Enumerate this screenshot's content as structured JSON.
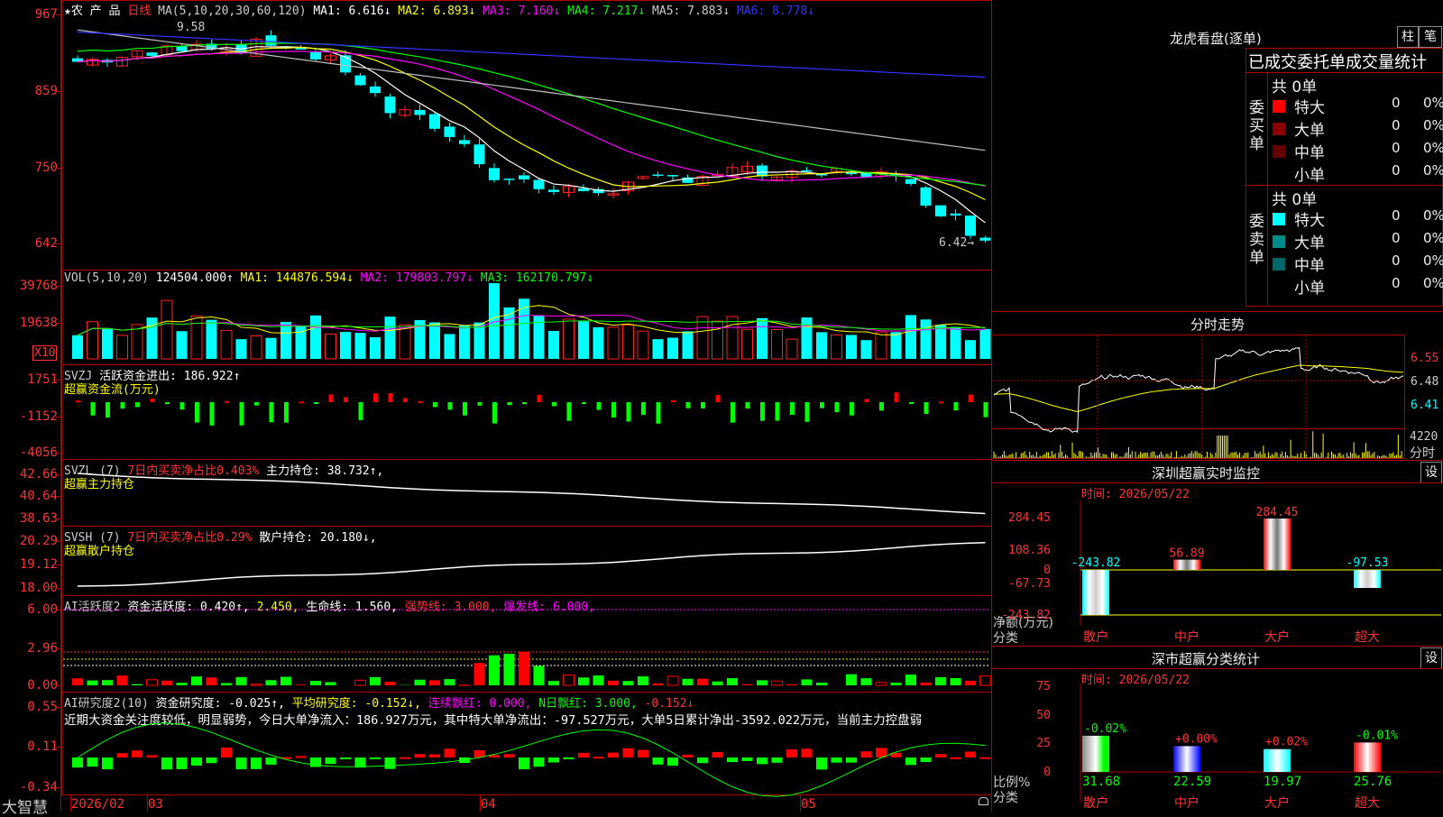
{
  "colors": {
    "up": "#ff2020",
    "down": "#00ffff",
    "grid": "#b00000",
    "bg": "#000000",
    "ma1": "#ffffff",
    "ma2": "#ffff00",
    "ma3": "#ff00ff",
    "ma4": "#00ff00",
    "ma5": "#c0c0c0",
    "ma6": "#3333ff"
  },
  "main": {
    "title": "★农 产 品",
    "period": "日线",
    "ma_params": "MA(5,10,20,30,60,120)",
    "ma1": "MA1: 6.616↓",
    "ma2": "MA2: 6.893↓",
    "ma3": "MA3: 7.160↓",
    "ma4": "MA4: 7.217↓",
    "ma5": "MA5: 7.883↓",
    "ma6": "MA6: 8.778↓",
    "y_ticks": [
      "967",
      "859",
      "750",
      "642"
    ],
    "high_mark": "9.58",
    "low_mark": "6.42→"
  },
  "vol": {
    "params": "VOL(5,10,20)",
    "value": "124504.000↑",
    "ma1": "MA1: 144876.594↓",
    "ma2": "MA2: 179803.797↓",
    "ma3": "MA3: 162170.797↓",
    "y_ticks": [
      "39768",
      "19638"
    ],
    "unit": "X10"
  },
  "svzj": {
    "name": "SVZJ",
    "label": "活跃资金进出: 186.922↑",
    "sub": "超赢资金流(万元)",
    "y_ticks": [
      "1751",
      "-1152",
      "-4056"
    ]
  },
  "svzl": {
    "name": "SVZL (7)",
    "ratio": "7日内买卖净占比0.403%",
    "label": "主力持仓: 38.732↑,",
    "sub": "超赢主力持仓",
    "y_ticks": [
      "42.66",
      "40.64",
      "38.63"
    ]
  },
  "svsh": {
    "name": "SVSH (7)",
    "ratio": "7日内买卖净占比0.29%",
    "label": "散户持仓: 20.180↓,",
    "sub": "超赢散户持仓",
    "y_ticks": [
      "20.29",
      "19.12",
      "18.00"
    ]
  },
  "ai1": {
    "name": "AI活跃度2",
    "label": "资金活跃度: 0.420↑,",
    "v2": "2.450,",
    "v3": "生命线: 1.560,",
    "v4": "强势线: 3.000,",
    "v5": "爆发线: 6.000,",
    "y_ticks": [
      "6.00",
      "2.96",
      "0.00"
    ]
  },
  "ai2": {
    "name": "AI研究度2(10)",
    "label": "资金研究度: -0.025↑,",
    "v2": "平均研究度: -0.152↓,",
    "v3": "连续飘红: 0.000,",
    "v4": "N日飘红: 3.000,",
    "v5": "-0.152↓",
    "comment": "近期大资金关注度较低，明显弱势，今日大单净流入：186.927万元，其中特大单净流出：-97.527万元，大单5日累计净出-3592.022万元，当前主力控盘弱",
    "y_ticks": [
      "0.55",
      "0.11",
      "-0.34"
    ]
  },
  "xaxis": {
    "brand": "大智慧",
    "labels": [
      "2026/02",
      "03",
      "04",
      "05"
    ]
  },
  "longhu": {
    "title": "龙虎看盘(逐单)",
    "btn1": "柱",
    "btn2": "笔",
    "header": "已成交委托单成交量统计",
    "buy_label": "委买单",
    "sell_label": "委卖单",
    "buy_total": "共 0单",
    "sell_total": "共 0单",
    "rows": [
      {
        "name": "特大",
        "count": "0",
        "pct": "0%",
        "color": "#ff0000"
      },
      {
        "name": "大单",
        "count": "0",
        "pct": "0%",
        "color": "#8b0000"
      },
      {
        "name": "中单",
        "count": "0",
        "pct": "0%",
        "color": "#660000"
      },
      {
        "name": "小单",
        "count": "0",
        "pct": "0%",
        "color": "#000000"
      }
    ],
    "sell_rows": [
      {
        "name": "特大",
        "count": "0",
        "pct": "0%",
        "color": "#00ffff"
      },
      {
        "name": "大单",
        "count": "0",
        "pct": "0%",
        "color": "#008b8b"
      },
      {
        "name": "中单",
        "count": "0",
        "pct": "0%",
        "color": "#006666"
      },
      {
        "name": "小单",
        "count": "0",
        "pct": "0%",
        "color": "#000000"
      }
    ]
  },
  "intraday": {
    "title": "分时走势",
    "y_ticks": [
      "6.55",
      "6.48",
      "6.41"
    ],
    "vol_tick": "4220",
    "vol_label": "分时"
  },
  "monitor": {
    "title": "深圳超赢实时监控",
    "btn": "设",
    "time": "时间: 2026/05/22",
    "y_ticks": [
      "284.45",
      "108.36",
      "0",
      "-67.73",
      "-243.82"
    ],
    "ylabel1": "净额(万元)",
    "ylabel2": "分类",
    "categories": [
      "散户",
      "中户",
      "大户",
      "超大"
    ],
    "values": [
      -243.82,
      56.89,
      284.45,
      -97.53
    ],
    "value_labels": [
      "-243.82",
      "56.89",
      "284.45",
      "-97.53"
    ]
  },
  "classify": {
    "title": "深市超赢分类统计",
    "btn": "设",
    "time": "时间: 2026/05/22",
    "y_ticks": [
      "75",
      "50",
      "25",
      "0"
    ],
    "ylabel1": "比例%",
    "ylabel2": "分类",
    "categories": [
      "散户",
      "中户",
      "大户",
      "超大"
    ],
    "values": [
      31.68,
      22.59,
      19.97,
      25.76
    ],
    "value_labels": [
      "31.68",
      "22.59",
      "19.97",
      "25.76"
    ],
    "changes": [
      "-0.02%",
      "+0.00%",
      "+0.02%",
      "-0.01%"
    ]
  }
}
